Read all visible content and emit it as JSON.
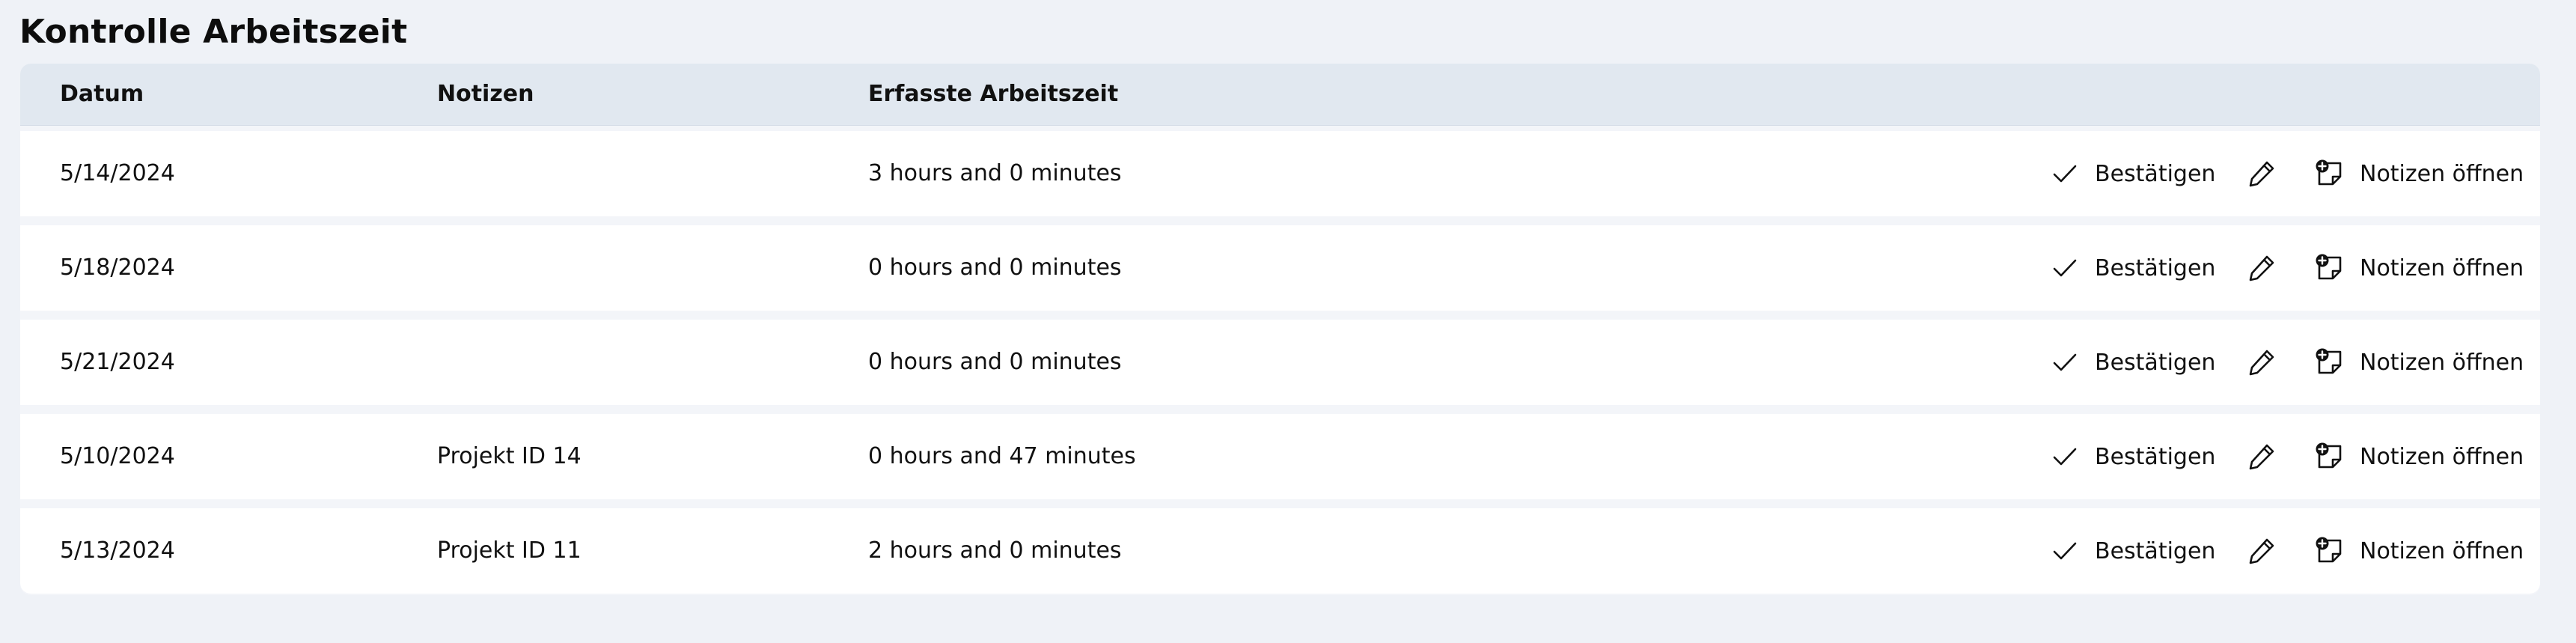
{
  "page": {
    "title": "Kontrolle Arbeitszeit"
  },
  "table": {
    "headers": {
      "date": "Datum",
      "notes": "Notizen",
      "time": "Erfasste Arbeitszeit"
    },
    "rows": [
      {
        "date": "5/14/2024",
        "notes": "",
        "time": "3 hours and 0 minutes"
      },
      {
        "date": "5/18/2024",
        "notes": "",
        "time": "0 hours and 0 minutes"
      },
      {
        "date": "5/21/2024",
        "notes": "",
        "time": "0 hours and 0 minutes"
      },
      {
        "date": "5/10/2024",
        "notes": "Projekt ID 14",
        "time": "0 hours and 47 minutes"
      },
      {
        "date": "5/13/2024",
        "notes": "Projekt ID 11",
        "time": "2 hours and 0 minutes"
      }
    ]
  },
  "actions": {
    "confirm_label": "Bestätigen",
    "open_notes_label": "Notizen öffnen",
    "confirm_icon": "check-icon",
    "edit_icon": "pencil-icon",
    "open_notes_icon": "note-add-icon"
  },
  "colors": {
    "page_background": "#eff2f7",
    "header_background": "#e1e8f0",
    "row_background": "#ffffff",
    "text": "#111111"
  }
}
